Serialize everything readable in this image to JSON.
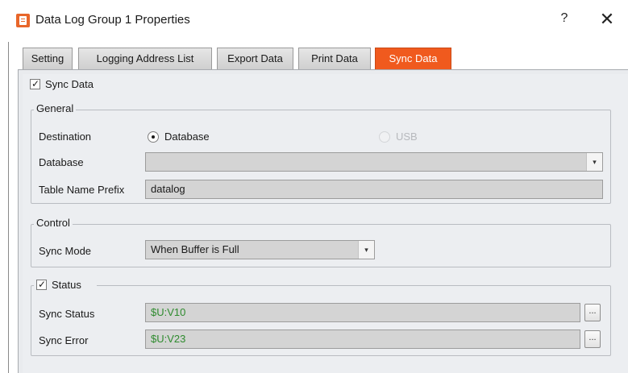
{
  "window": {
    "title": "Data Log Group 1 Properties",
    "help_label": "?",
    "close_label": "✕"
  },
  "tabs": [
    {
      "label": "Setting"
    },
    {
      "label": "Logging Address List"
    },
    {
      "label": "Export Data"
    },
    {
      "label": "Print Data"
    },
    {
      "label": "Sync Data",
      "active": true
    }
  ],
  "sync_data": {
    "label": "Sync Data",
    "checked": true
  },
  "general": {
    "legend": "General",
    "destination_label": "Destination",
    "option_database": "Database",
    "option_usb": "USB",
    "selected": "Database",
    "database_label": "Database",
    "database_value": "",
    "table_prefix_label": "Table Name Prefix",
    "table_prefix_value": "datalog"
  },
  "control": {
    "legend": "Control",
    "sync_mode_label": "Sync Mode",
    "sync_mode_value": "When Buffer is Full"
  },
  "status": {
    "legend": "Status",
    "checked": true,
    "sync_status_label": "Sync Status",
    "sync_status_value": "$U:V10",
    "sync_error_label": "Sync Error",
    "sync_error_value": "$U:V23",
    "browse_label": "..."
  },
  "colors": {
    "active_tab": "#f05a1e",
    "address_text": "#2e8b2e"
  },
  "icons": {
    "app": "app-document-icon",
    "dropdown": "chevron-down-icon",
    "checkbox": "checkmark-icon"
  }
}
